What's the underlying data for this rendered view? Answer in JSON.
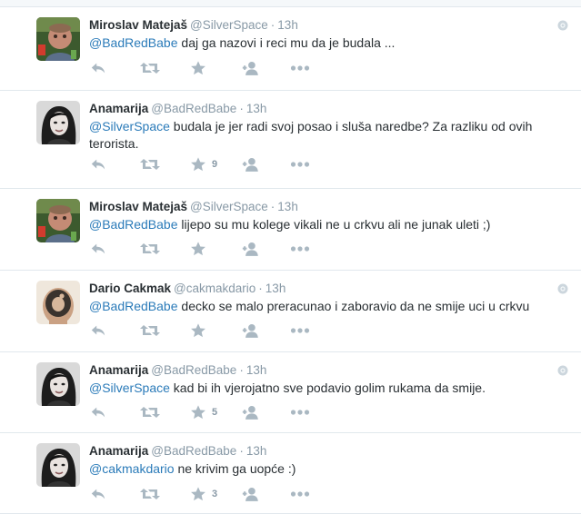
{
  "tweets": [
    {
      "fullname": "Miroslav Matejaš",
      "username": "@SilverSpace",
      "time": "13h",
      "mention": "@BadRedBabe",
      "text": " daj ga nazovi i reci mu da je budala ...",
      "favorites": "",
      "avatar": "avatar-miroslav",
      "has_more": true
    },
    {
      "fullname": "Anamarija",
      "username": "@BadRedBabe",
      "time": "13h",
      "mention": "@SilverSpace",
      "text": " budala je jer radi svoj posao i sluša naredbe? Za razliku od ovih terorista.",
      "favorites": "9",
      "avatar": "avatar-anamarija",
      "has_more": false
    },
    {
      "fullname": "Miroslav Matejaš",
      "username": "@SilverSpace",
      "time": "13h",
      "mention": "@BadRedBabe",
      "text": " lijepo su mu kolege vikali ne u crkvu ali ne junak uleti ;)",
      "favorites": "",
      "avatar": "avatar-miroslav",
      "has_more": false
    },
    {
      "fullname": "Dario Cakmak",
      "username": "@cakmakdario",
      "time": "13h",
      "mention": "@BadRedBabe",
      "text": " decko se malo preracunao i zaboravio da ne smije uci u crkvu",
      "favorites": "",
      "avatar": "avatar-dario",
      "has_more": true
    },
    {
      "fullname": "Anamarija",
      "username": "@BadRedBabe",
      "time": "13h",
      "mention": "@SilverSpace",
      "text": " kad bi ih vjerojatno sve podavio golim rukama da smije.",
      "favorites": "5",
      "avatar": "avatar-anamarija",
      "has_more": true
    },
    {
      "fullname": "Anamarija",
      "username": "@BadRedBabe",
      "time": "13h",
      "mention": "@cakmakdario",
      "text": " ne krivim ga uopće :)",
      "favorites": "3",
      "avatar": "avatar-anamarija",
      "has_more": false
    }
  ],
  "icons": {
    "reply": "reply-icon",
    "retweet": "retweet-icon",
    "favorite": "star-icon",
    "follow": "follow-icon",
    "more": "more-icon",
    "tweet_menu": "gear-icon"
  },
  "colors": {
    "mention": "#2b7bb9",
    "meta": "#8899a6",
    "icon": "#aab8c2",
    "divider": "#e1e8ed"
  }
}
